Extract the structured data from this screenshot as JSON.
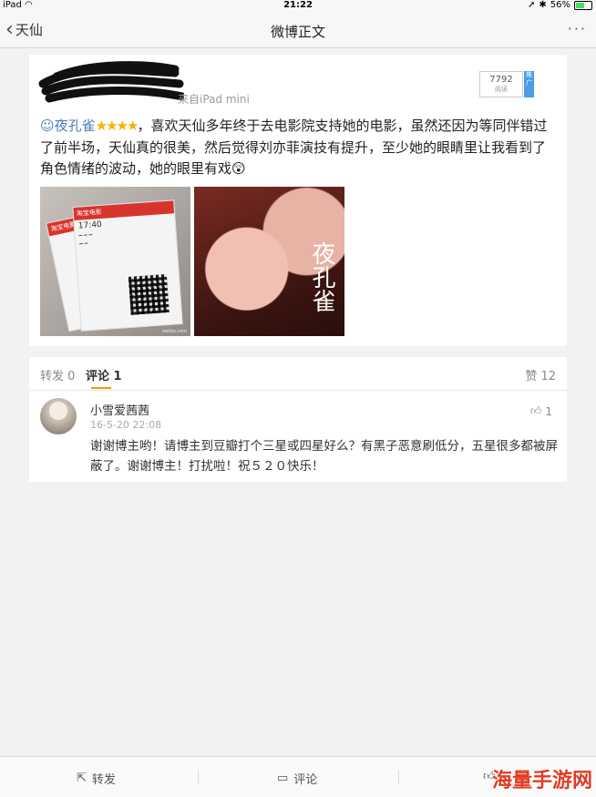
{
  "status": {
    "device": "iPad",
    "time": "21:22",
    "battery": "56%",
    "battery_level": 0.56
  },
  "nav": {
    "back_label": "天仙",
    "title": "微博正文",
    "more": "···"
  },
  "post": {
    "source": "来自iPad mini",
    "views": "7792",
    "views_label": "阅读",
    "ad_tag": "推广",
    "user": "夜孔雀",
    "stars": "★★★★",
    "text": "，喜欢天仙多年终于去电影院支持她的电影，虽然还因为等同伴错过了前半场，天仙真的很美，然后觉得刘亦菲演技有提升，至少她的眼睛里让我看到了角色情绪的波动，她的眼里有戏",
    "emoji": "😲",
    "ticket_brand": "淘宝电影",
    "ticket_time": "17:40",
    "image_watermark": "weibo.com",
    "poster_title": "夜孔雀"
  },
  "tabs": {
    "repost": "转发 0",
    "comments": "评论 1",
    "likes": "赞 12"
  },
  "comment": {
    "name": "小雪爱茜茜",
    "time": "16-5-20 22:08",
    "likes": "1",
    "text": "谢谢博主哟！请博主到豆瓣打个三星或四星好么？有黑子恶意刷低分，五星很多都被屏蔽了。谢谢博主！打扰啦！祝５２０快乐！"
  },
  "bottom": {
    "repost": "转发",
    "comment": "评论",
    "brand": "海量手游网"
  },
  "colors": {
    "accent": "#f29b00",
    "link": "#4a7bb7",
    "star": "#f5b400"
  }
}
